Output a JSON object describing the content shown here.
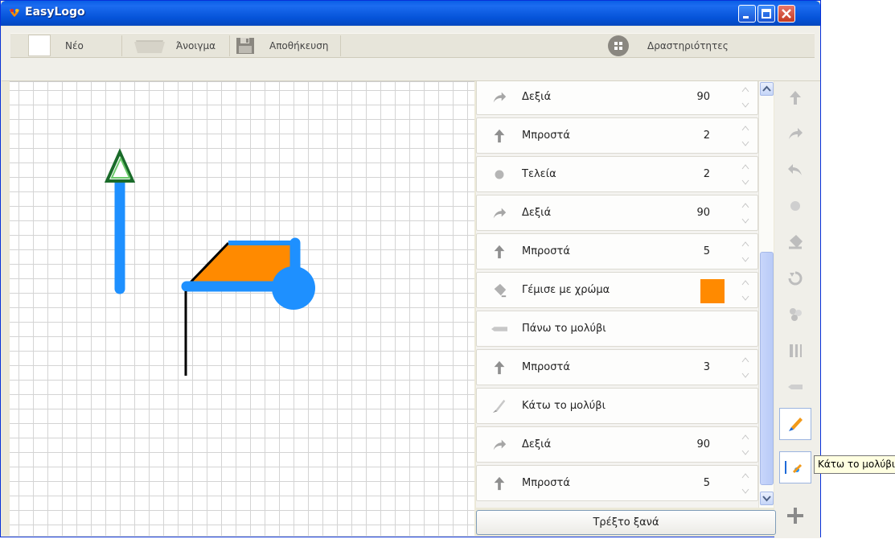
{
  "window": {
    "title": "EasyLogo"
  },
  "toolbar": {
    "new_label": "Νέο",
    "open_label": "Άνοιγμα",
    "save_label": "Αποθήκευση",
    "activities_label": "Δραστηριότητες"
  },
  "commands": [
    {
      "label": "Δεξιά",
      "value": "90",
      "icon": "turn-right-icon",
      "spinner": true
    },
    {
      "label": "Μπροστά",
      "value": "2",
      "icon": "forward-arrow-icon",
      "spinner": true
    },
    {
      "label": "Τελεία",
      "value": "2",
      "icon": "dot-icon",
      "spinner": true
    },
    {
      "label": "Δεξιά",
      "value": "90",
      "icon": "turn-right-icon",
      "spinner": true
    },
    {
      "label": "Μπροστά",
      "value": "5",
      "icon": "forward-arrow-icon",
      "spinner": true
    },
    {
      "label": "Γέμισε με χρώμα",
      "value": "",
      "icon": "paint-bucket-icon",
      "spinner": true,
      "swatch": "#ff8a00"
    },
    {
      "label": "Πάνω το μολύβι",
      "value": "",
      "icon": "pen-up-icon",
      "spinner": false
    },
    {
      "label": "Μπροστά",
      "value": "3",
      "icon": "forward-arrow-icon",
      "spinner": true
    },
    {
      "label": "Κάτω το μολύβι",
      "value": "",
      "icon": "pen-down-icon",
      "spinner": false
    },
    {
      "label": "Δεξιά",
      "value": "90",
      "icon": "turn-right-icon",
      "spinner": true
    },
    {
      "label": "Μπροστά",
      "value": "5",
      "icon": "forward-arrow-icon",
      "spinner": true
    }
  ],
  "run_button": {
    "label": "Τρέξτο ξανά"
  },
  "tooltip": {
    "text": "Κάτω το μολύβι"
  },
  "palette": [
    "forward-icon",
    "turn-right-icon",
    "turn-left-icon",
    "dot-icon",
    "paint-bucket-icon",
    "repeat-icon",
    "color-icon",
    "pen-width-icon",
    "pen-up-icon",
    "pen-down-icon",
    "pen-down-selected-icon",
    "add-icon"
  ],
  "colors": {
    "line": "#1e90ff",
    "fill": "#ff8a00",
    "turtle": "#1a7a2a",
    "title_bar": "#0553d8"
  }
}
